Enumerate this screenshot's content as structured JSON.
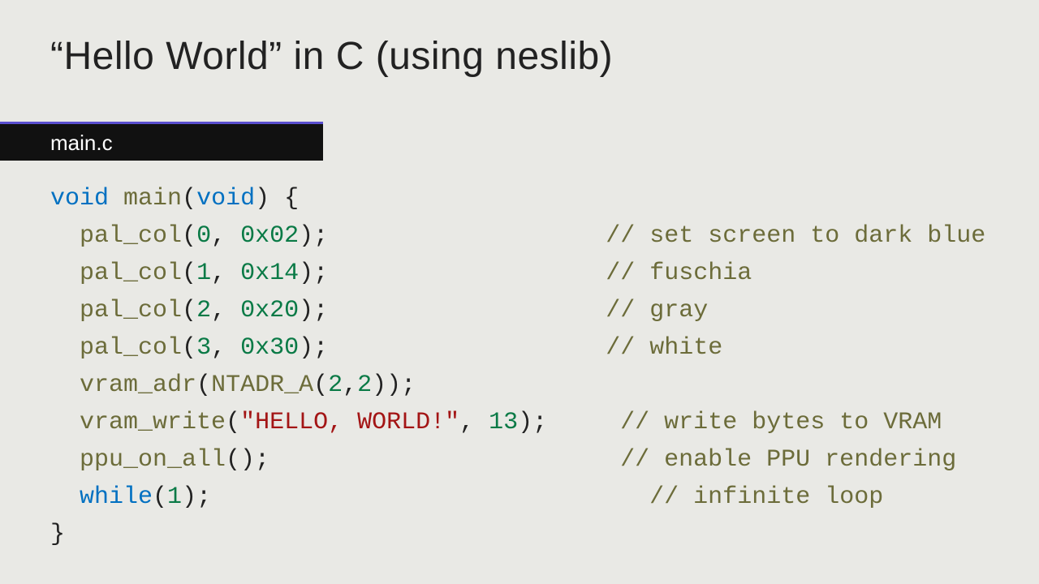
{
  "slide": {
    "title": "“Hello World” in C (using neslib)",
    "tab": "main.c"
  },
  "code": {
    "kw_void1": "void",
    "fn_main": "main",
    "sig_open": "(",
    "kw_void2": "void",
    "sig_close": ") {",
    "indent": "  ",
    "fn_pal_col": "pal_col",
    "p1_open": "(",
    "p1_a": "0",
    "p1_c": ", ",
    "p1_b": "0x02",
    "p1_close": ");",
    "c1": "// set screen to dark blue",
    "p2_open": "(",
    "p2_a": "1",
    "p2_c": ", ",
    "p2_b": "0x14",
    "p2_close": ");",
    "c2": "// fuschia",
    "p3_open": "(",
    "p3_a": "2",
    "p3_c": ", ",
    "p3_b": "0x20",
    "p3_close": ");",
    "c3": "// gray",
    "p4_open": "(",
    "p4_a": "3",
    "p4_c": ", ",
    "p4_b": "0x30",
    "p4_close": ");",
    "c4": "// white",
    "fn_vram_adr": "vram_adr",
    "va_open": "(",
    "fn_ntadr": "NTADR_A",
    "va_inner_open": "(",
    "va_arg1": "2",
    "va_comma": ",",
    "va_arg2": "2",
    "va_inner_close": ")",
    "va_close": ");",
    "fn_vram_write": "vram_write",
    "vw_open": "(",
    "vw_str": "\"HELLO, WORLD!\"",
    "vw_comma": ", ",
    "vw_len": "13",
    "vw_close": ");",
    "c6": "// write bytes to VRAM",
    "fn_ppu": "ppu_on_all",
    "ppu_call": "();",
    "c7": "// enable PPU rendering",
    "kw_while": "while",
    "wh_open": "(",
    "wh_arg": "1",
    "wh_close": ");",
    "c8": "// infinite loop",
    "brace_close": "}",
    "gap_comment": "                   ",
    "gap_comment_vw": "     ",
    "gap_comment_ppu": "                        ",
    "gap_comment_wh": "                              "
  }
}
